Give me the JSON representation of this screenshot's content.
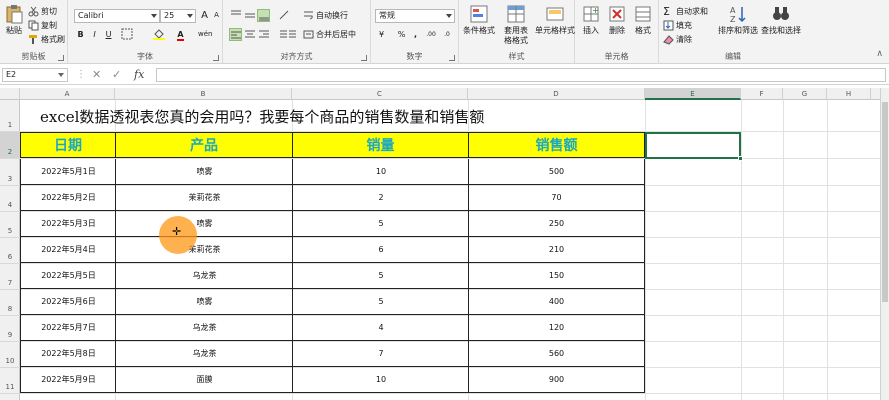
{
  "ribbon": {
    "clipboard": {
      "label": "剪贴板",
      "paste": "粘贴",
      "cut": "剪切",
      "copy": "复制",
      "format_painter": "格式刷"
    },
    "font": {
      "label": "字体",
      "name": "Calibri",
      "size": "25",
      "grow": "A",
      "shrink": "A",
      "bold": "B",
      "italic": "I",
      "underline": "U",
      "phonetic": "wén"
    },
    "alignment": {
      "label": "对齐方式",
      "wrap": "自动换行",
      "merge": "合并后居中"
    },
    "number": {
      "label": "数字",
      "format": "常规",
      "currency": "¥",
      "percent": "%",
      "comma": ",",
      "inc": ".00",
      "dec": ".0"
    },
    "styles": {
      "label": "样式",
      "conditional": "条件格式",
      "table": "套用表格格式",
      "cell_styles": "单元格样式"
    },
    "cells": {
      "label": "单元格",
      "insert": "插入",
      "delete": "删除",
      "format": "格式"
    },
    "editing": {
      "label": "编辑",
      "autosum": "自动求和",
      "fill": "填充",
      "clear": "清除",
      "sort": "排序和筛选",
      "find": "查找和选择"
    }
  },
  "formula_bar": {
    "name_box": "E2",
    "cancel": "✕",
    "enter": "✓",
    "fx": "fx",
    "content": ""
  },
  "columns": [
    "A",
    "B",
    "C",
    "D",
    "E",
    "F",
    "G",
    "H"
  ],
  "active_column": "E",
  "rows": [
    "1",
    "2",
    "3",
    "4",
    "5",
    "6",
    "7",
    "8",
    "9",
    "10",
    "11"
  ],
  "active_row": "2",
  "sheet": {
    "title": "excel数据透视表您真的会用吗？我要每个商品的销售数量和销售额",
    "headers": [
      "日期",
      "产品",
      "销量",
      "销售额"
    ],
    "header_fill": "#ffff00",
    "header_text_color": "#1ba8c2",
    "data": [
      [
        "2022年5月1日",
        "喷雾",
        "10",
        "500"
      ],
      [
        "2022年5月2日",
        "茉莉花茶",
        "2",
        "70"
      ],
      [
        "2022年5月3日",
        "喷雾",
        "5",
        "250"
      ],
      [
        "2022年5月4日",
        "茉莉花茶",
        "6",
        "210"
      ],
      [
        "2022年5月5日",
        "乌龙茶",
        "5",
        "150"
      ],
      [
        "2022年5月6日",
        "喷雾",
        "5",
        "400"
      ],
      [
        "2022年5月7日",
        "乌龙茶",
        "4",
        "120"
      ],
      [
        "2022年5月8日",
        "乌龙茶",
        "7",
        "560"
      ],
      [
        "2022年5月9日",
        "面膜",
        "10",
        "900"
      ]
    ]
  },
  "colors": {
    "accent": "#217346",
    "cursor_halo": "#ff9614"
  }
}
